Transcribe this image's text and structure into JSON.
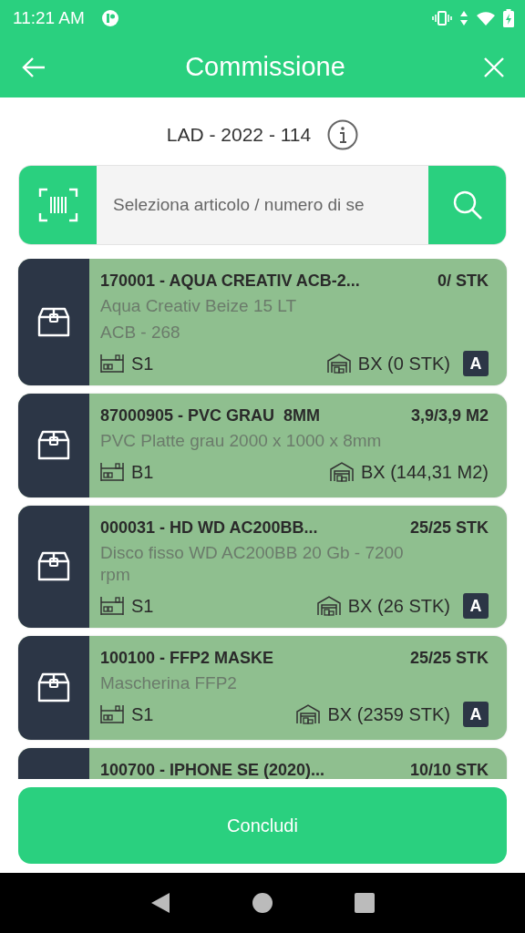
{
  "status_bar": {
    "time": "11:21 AM"
  },
  "header": {
    "title": "Commissione"
  },
  "order": {
    "number": "LAD - 2022 - 114"
  },
  "search": {
    "placeholder": "Seleziona articolo / numero di se"
  },
  "items": [
    {
      "title": "170001 - AQUA CREATIV ACB-2...",
      "quantity": "0/ STK",
      "description": [
        "Aqua Creativ Beize 15 LT",
        "ACB - 268"
      ],
      "location": "S1",
      "stock": "BX (0 STK)",
      "badge": "A"
    },
    {
      "title": "87000905 - PVC GRAU  8MM",
      "quantity": "3,9/3,9 M2",
      "description": [
        "PVC Platte grau 2000 x 1000 x 8mm"
      ],
      "location": "B1",
      "stock": "BX (144,31 M2)"
    },
    {
      "title": "000031 - HD WD AC200BB...",
      "quantity": "25/25 STK",
      "description": [
        "Disco fisso WD AC200BB 20 Gb - 7200 rpm"
      ],
      "location": "S1",
      "stock": "BX (26 STK)",
      "badge": "A"
    },
    {
      "title": "100100 - FFP2 MASKE",
      "quantity": "25/25 STK",
      "description": [
        "Mascherina FFP2"
      ],
      "location": "S1",
      "stock": "BX (2359 STK)",
      "badge": "A"
    },
    {
      "title": "100700 - IPHONE SE (2020)...",
      "quantity": "10/10 STK"
    }
  ],
  "footer": {
    "button": "Concludi"
  }
}
